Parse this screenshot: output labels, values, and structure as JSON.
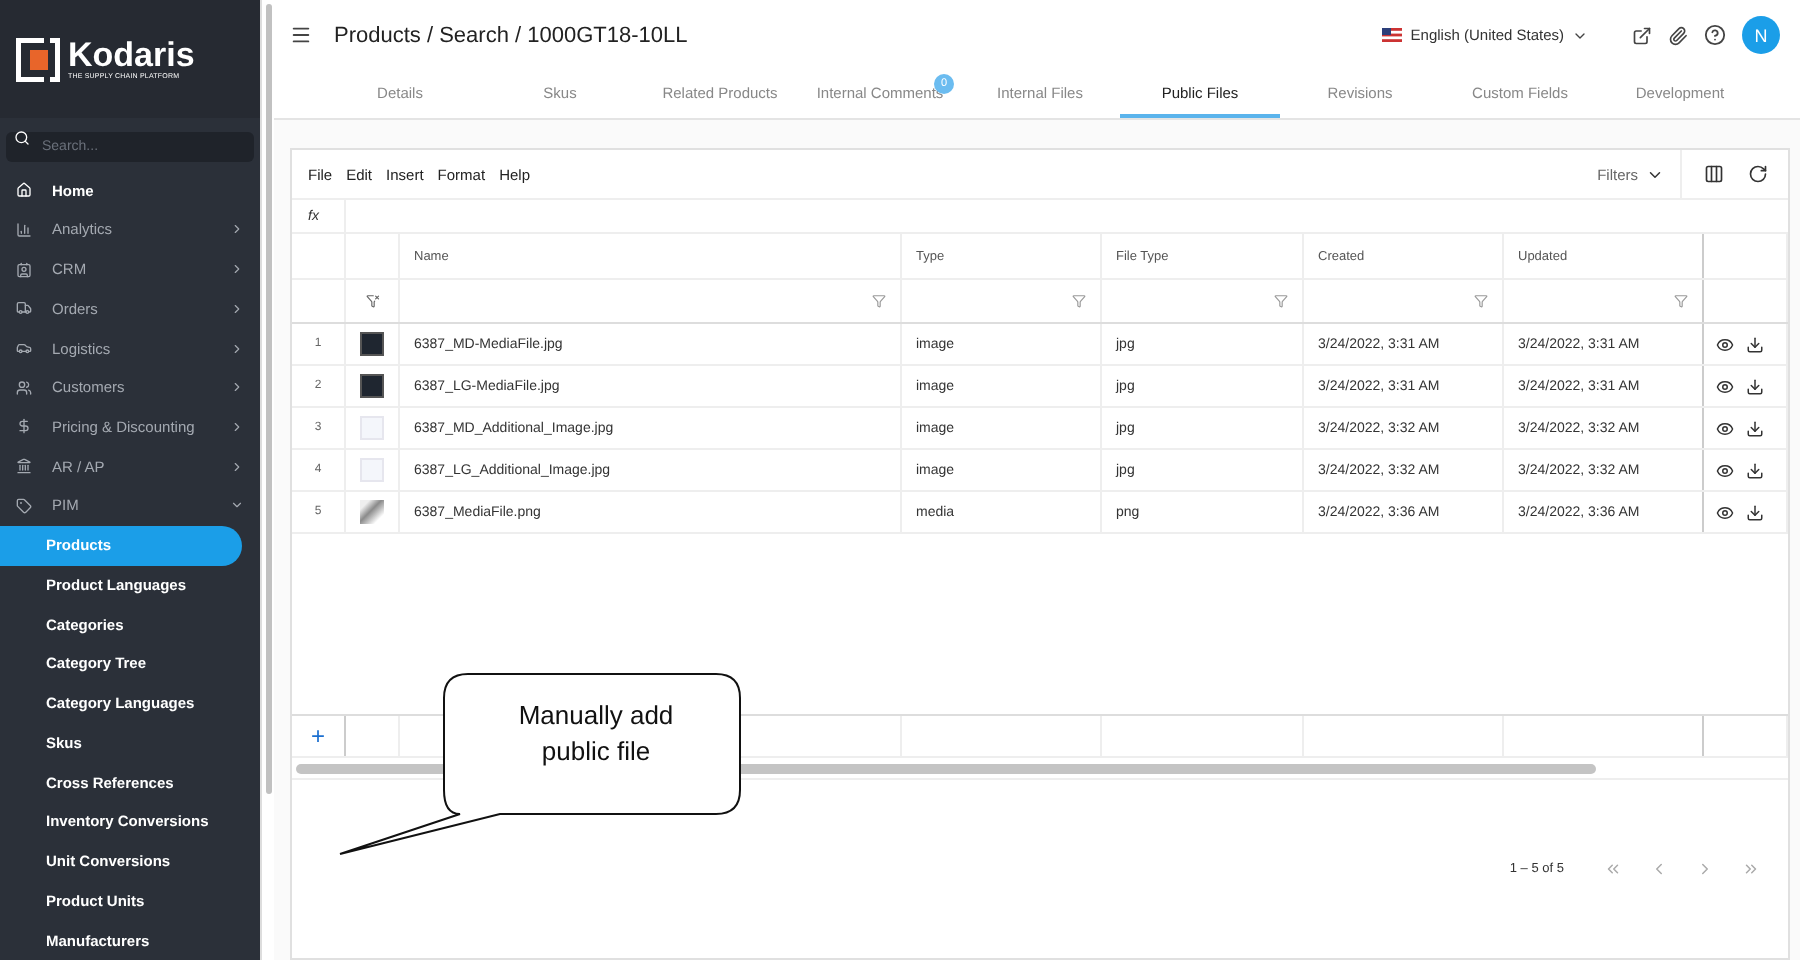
{
  "sidebar": {
    "brand": "Kodaris",
    "tagline": "THE SUPPLY CHAIN PLATFORM",
    "search": {
      "placeholder": "Search..."
    },
    "items": [
      {
        "label": "Home",
        "kind": "link"
      },
      {
        "label": "Analytics",
        "kind": "group",
        "expanded": false
      },
      {
        "label": "CRM",
        "kind": "group",
        "expanded": false
      },
      {
        "label": "Orders",
        "kind": "group",
        "expanded": false
      },
      {
        "label": "Logistics",
        "kind": "group",
        "expanded": false
      },
      {
        "label": "Customers",
        "kind": "group",
        "expanded": false
      },
      {
        "label": "Pricing & Discounting",
        "kind": "group",
        "expanded": false
      },
      {
        "label": "AR / AP",
        "kind": "group",
        "expanded": false
      },
      {
        "label": "PIM",
        "kind": "group",
        "expanded": true,
        "children": [
          {
            "label": "Products",
            "selected": true
          },
          {
            "label": "Product Languages",
            "selected": false
          },
          {
            "label": "Categories",
            "selected": false
          },
          {
            "label": "Category Tree",
            "selected": false
          },
          {
            "label": "Category Languages",
            "selected": false
          },
          {
            "label": "Skus",
            "selected": false
          },
          {
            "label": "Cross References",
            "selected": false
          },
          {
            "label": "Inventory Conversions",
            "selected": false
          },
          {
            "label": "Unit Conversions",
            "selected": false
          },
          {
            "label": "Product Units",
            "selected": false
          },
          {
            "label": "Manufacturers",
            "selected": false
          }
        ]
      }
    ]
  },
  "header": {
    "breadcrumb": "Products / Search / 1000GT18-10LL",
    "language": "English (United States)",
    "avatar": "N"
  },
  "tabs": [
    {
      "label": "Details",
      "selected": false
    },
    {
      "label": "Skus",
      "selected": false
    },
    {
      "label": "Related Products",
      "selected": false
    },
    {
      "label": "Internal Comments",
      "selected": false,
      "badge": "0"
    },
    {
      "label": "Internal Files",
      "selected": false
    },
    {
      "label": "Public Files",
      "selected": true
    },
    {
      "label": "Revisions",
      "selected": false
    },
    {
      "label": "Custom Fields",
      "selected": false
    },
    {
      "label": "Development",
      "selected": false
    }
  ],
  "grid": {
    "menu": [
      "File",
      "Edit",
      "Insert",
      "Format",
      "Help"
    ],
    "filters": "Filters",
    "formula_label": "fx",
    "columns": [
      "Name",
      "Type",
      "File Type",
      "Created",
      "Updated"
    ],
    "rows": [
      {
        "number": "1",
        "kind": "dark",
        "cells": [
          "6387_MD-MediaFile.jpg",
          "image",
          "jpg",
          "3/24/2022, 3:31 AM",
          "3/24/2022, 3:31 AM"
        ]
      },
      {
        "number": "2",
        "kind": "dark",
        "cells": [
          "6387_LG-MediaFile.jpg",
          "image",
          "jpg",
          "3/24/2022, 3:31 AM",
          "3/24/2022, 3:31 AM"
        ]
      },
      {
        "number": "3",
        "kind": "light",
        "cells": [
          "6387_MD_Additional_Image.jpg",
          "image",
          "jpg",
          "3/24/2022, 3:32 AM",
          "3/24/2022, 3:32 AM"
        ]
      },
      {
        "number": "4",
        "kind": "light",
        "cells": [
          "6387_LG_Additional_Image.jpg",
          "image",
          "jpg",
          "3/24/2022, 3:32 AM",
          "3/24/2022, 3:32 AM"
        ]
      },
      {
        "number": "5",
        "kind": "part",
        "cells": [
          "6387_MediaFile.png",
          "media",
          "png",
          "3/24/2022, 3:36 AM",
          "3/24/2022, 3:36 AM"
        ]
      }
    ],
    "add_button": "+",
    "pagination": "1 – 5 of 5"
  },
  "callout": {
    "text": "Manually add public file"
  }
}
